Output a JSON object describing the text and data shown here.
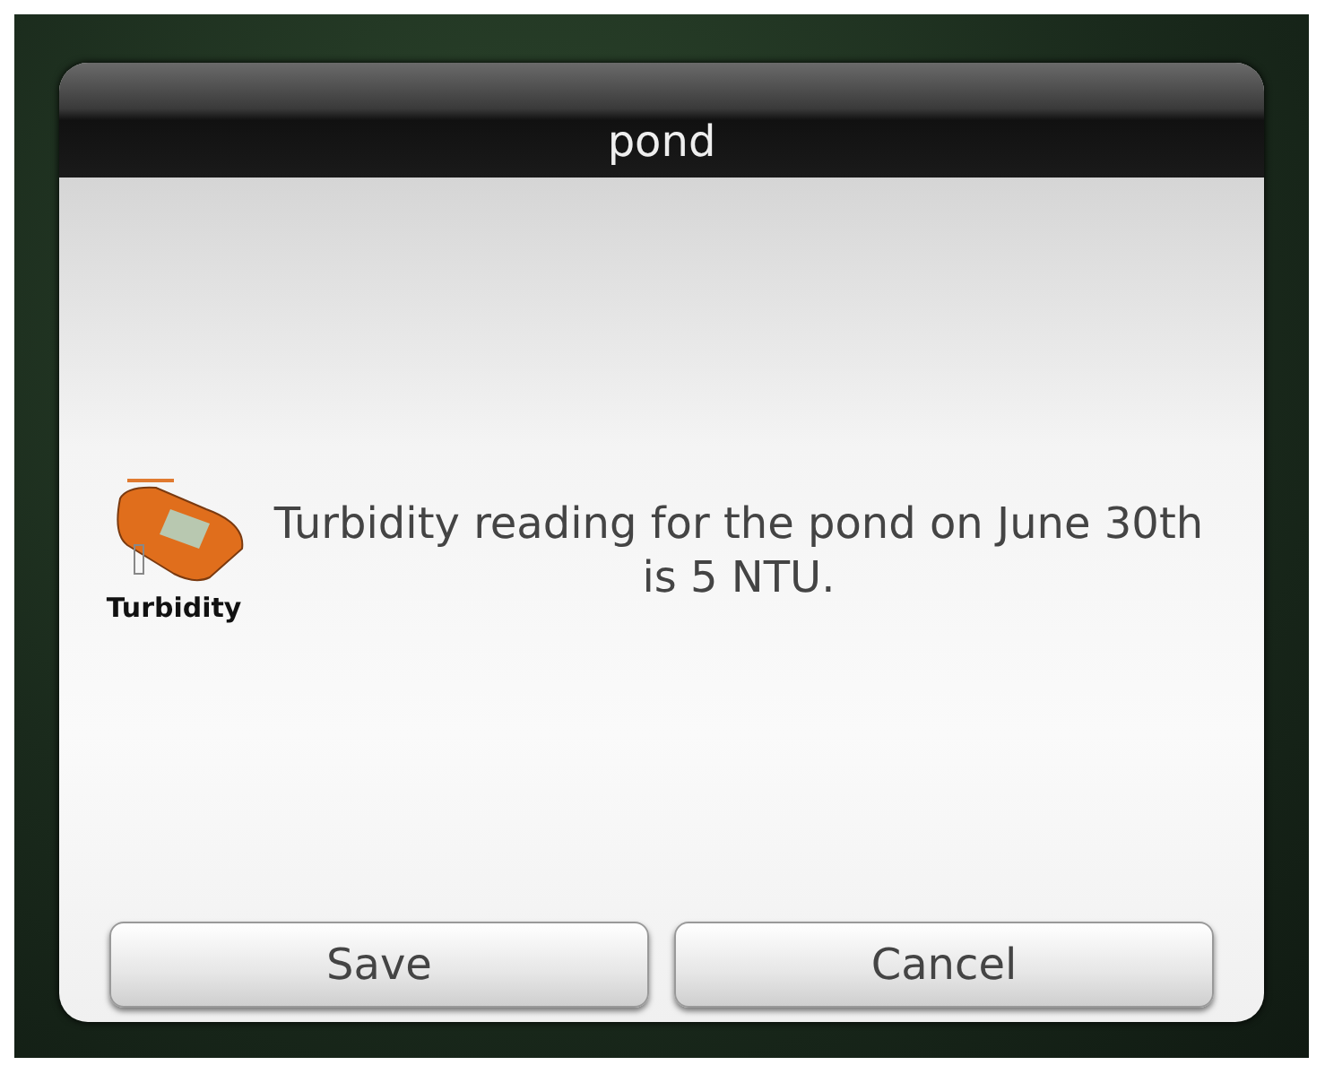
{
  "window": {
    "title": "pond"
  },
  "sensor": {
    "label": "Turbidity"
  },
  "message": "Turbidity reading for the pond on June 30th is 5 NTU.",
  "buttons": [
    "Save",
    "Cancel"
  ]
}
